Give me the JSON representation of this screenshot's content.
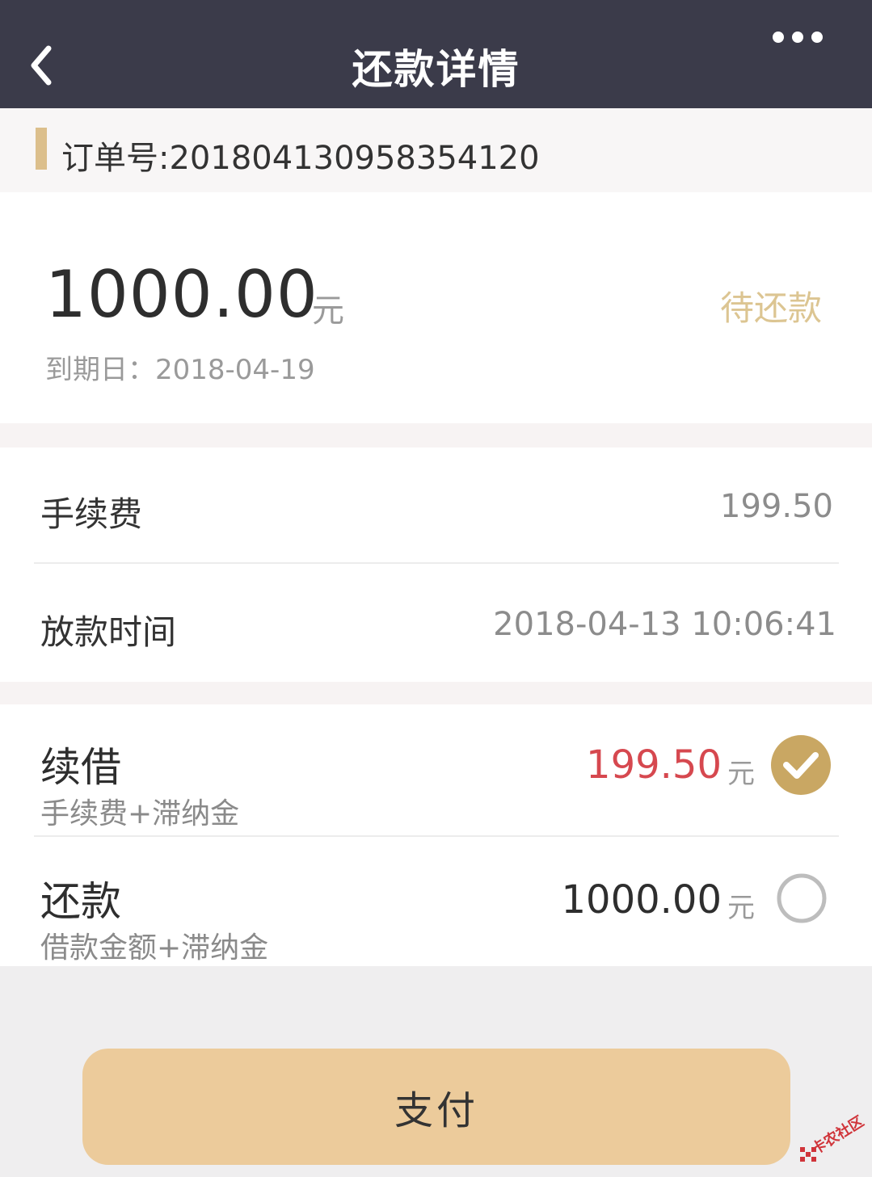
{
  "header": {
    "title": "还款详情",
    "back_icon": "chevron-left-icon",
    "more_icon": "more-dots-icon"
  },
  "order": {
    "text": "订单号:2018041309583541​20"
  },
  "loan": {
    "amount": "1000.00",
    "unit": "元",
    "status": "待还款",
    "due": "到期日：2018-04-19"
  },
  "info": {
    "fee_label": "手续费",
    "fee_value": "199.50",
    "time_label": "放款时间",
    "time_value": "2018-04-13 10:06:41"
  },
  "options": [
    {
      "title": "续借",
      "subtitle": "手续费+滞纳金",
      "amount": "199.50",
      "unit": "元",
      "selected": true,
      "amount_color": "#d6484f"
    },
    {
      "title": "还款",
      "subtitle": "借款金额+滞纳金",
      "amount": "1000.00",
      "unit": "元",
      "selected": false,
      "amount_color": "#2e2e2e"
    }
  ],
  "footer": {
    "pay_label": "支付"
  },
  "watermark": {
    "text": "卡农社区"
  },
  "colors": {
    "header": "#3b3b4a",
    "accent": "#dcbf8c",
    "check": "#c9a763",
    "pay": "#eccb9b"
  }
}
